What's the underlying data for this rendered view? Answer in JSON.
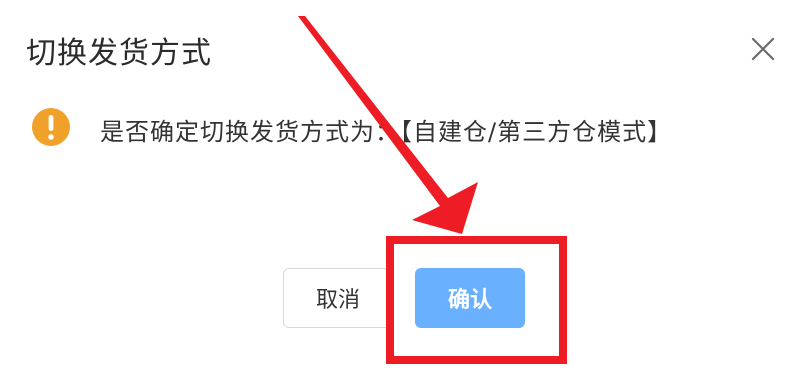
{
  "dialog": {
    "title": "切换发货方式",
    "message": "是否确定切换发货方式为：【自建仓/第三方仓模式】",
    "cancel_label": "取消",
    "confirm_label": "确认"
  },
  "colors": {
    "warning_icon": "#f0a12a",
    "confirm_button": "#69b1ff",
    "annotation_red": "#ee1c25"
  },
  "icons": {
    "warning": "warning-icon",
    "close": "close-icon",
    "annotation_arrow": "arrow-annotation"
  }
}
